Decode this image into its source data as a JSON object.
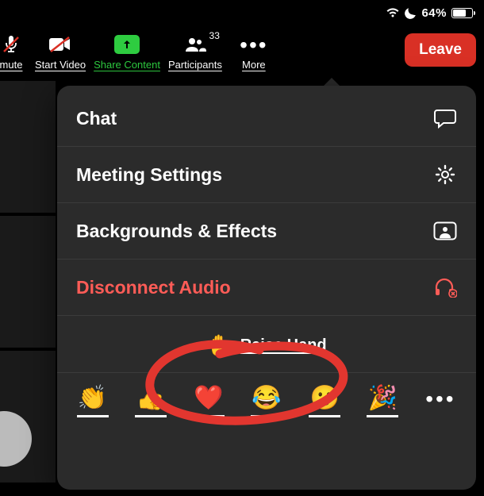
{
  "status": {
    "battery_pct": "64%"
  },
  "toolbar": {
    "unmute_label": "mute",
    "start_video_label": "Start Video",
    "share_label": "Share Content",
    "participants_label": "Participants",
    "participants_count": "33",
    "more_label": "More",
    "leave_label": "Leave"
  },
  "menu": {
    "chat_label": "Chat",
    "settings_label": "Meeting Settings",
    "backgrounds_label": "Backgrounds & Effects",
    "disconnect_label": "Disconnect Audio"
  },
  "raise_hand": {
    "emoji": "✋",
    "label": "Raise Hand"
  },
  "reactions": {
    "clap": "👏",
    "thumbs_up": "👍",
    "heart": "❤️",
    "joy": "😂",
    "open_mouth": "😮",
    "tada": "🎉"
  },
  "colors": {
    "danger": "#ff5c57",
    "share_green": "#2ecc40",
    "leave_red": "#d93025",
    "annotation_red": "#e2362f"
  }
}
